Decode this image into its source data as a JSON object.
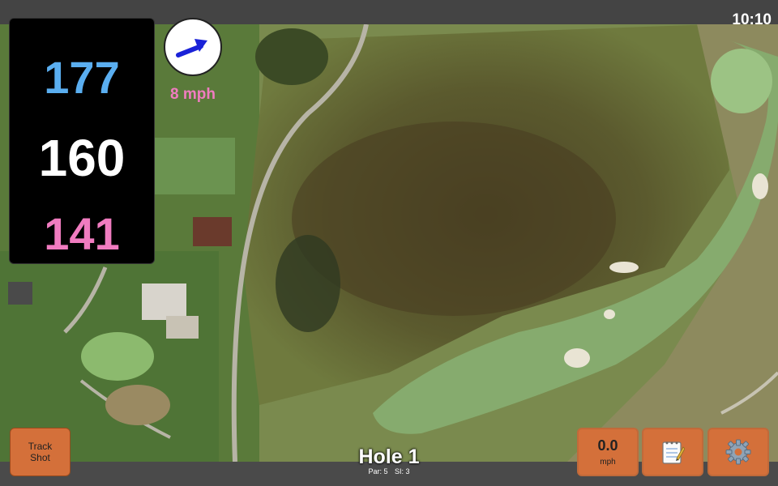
{
  "status": {
    "time": "10:10"
  },
  "distances": {
    "back": "177",
    "middle": "160",
    "front": "141",
    "back_color": "#5aaef0",
    "middle_color": "#ffffff",
    "front_color": "#f07cc0"
  },
  "wind": {
    "speed": "8 mph",
    "speed_color": "#f07cc0",
    "arrow_color": "#1a22d8",
    "direction_icon": "wind-arrow-icon"
  },
  "hole": {
    "title": "Hole 1",
    "par": "Par: 5",
    "si": "SI: 3"
  },
  "buttons": {
    "track_shot": "Track Shot",
    "speed_value": "0.0",
    "speed_unit": "mph",
    "notes_icon": "notepad-icon",
    "settings_icon": "gear-icon",
    "accent": "#d4703a"
  }
}
